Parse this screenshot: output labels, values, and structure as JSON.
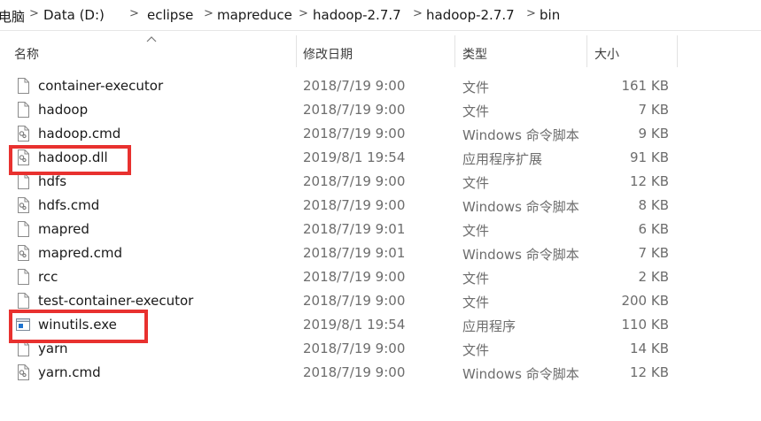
{
  "breadcrumb": {
    "items": [
      "电脑",
      "Data (D:)",
      "eclipse",
      "mapreduce",
      "hadoop-2.7.7",
      "hadoop-2.7.7",
      "bin"
    ]
  },
  "columns": {
    "name": "名称",
    "date": "修改日期",
    "type": "类型",
    "size": "大小"
  },
  "files": [
    {
      "name": "container-executor",
      "date": "2018/7/19 9:00",
      "type": "文件",
      "size": "161 KB",
      "icon": "blank-file-icon"
    },
    {
      "name": "hadoop",
      "date": "2018/7/19 9:00",
      "type": "文件",
      "size": "7 KB",
      "icon": "blank-file-icon"
    },
    {
      "name": "hadoop.cmd",
      "date": "2018/7/19 9:00",
      "type": "Windows 命令脚本",
      "size": "9 KB",
      "icon": "cmd-script-icon"
    },
    {
      "name": "hadoop.dll",
      "date": "2019/8/1 19:54",
      "type": "应用程序扩展",
      "size": "91 KB",
      "icon": "dll-gear-icon"
    },
    {
      "name": "hdfs",
      "date": "2018/7/19 9:00",
      "type": "文件",
      "size": "12 KB",
      "icon": "blank-file-icon"
    },
    {
      "name": "hdfs.cmd",
      "date": "2018/7/19 9:00",
      "type": "Windows 命令脚本",
      "size": "8 KB",
      "icon": "cmd-script-icon"
    },
    {
      "name": "mapred",
      "date": "2018/7/19 9:01",
      "type": "文件",
      "size": "6 KB",
      "icon": "blank-file-icon"
    },
    {
      "name": "mapred.cmd",
      "date": "2018/7/19 9:01",
      "type": "Windows 命令脚本",
      "size": "7 KB",
      "icon": "cmd-script-icon"
    },
    {
      "name": "rcc",
      "date": "2018/7/19 9:00",
      "type": "文件",
      "size": "2 KB",
      "icon": "blank-file-icon"
    },
    {
      "name": "test-container-executor",
      "date": "2018/7/19 9:00",
      "type": "文件",
      "size": "200 KB",
      "icon": "blank-file-icon"
    },
    {
      "name": "winutils.exe",
      "date": "2019/8/1 19:54",
      "type": "应用程序",
      "size": "110 KB",
      "icon": "exe-window-icon"
    },
    {
      "name": "yarn",
      "date": "2018/7/19 9:00",
      "type": "文件",
      "size": "14 KB",
      "icon": "blank-file-icon"
    },
    {
      "name": "yarn.cmd",
      "date": "2018/7/19 9:00",
      "type": "Windows 命令脚本",
      "size": "12 KB",
      "icon": "cmd-script-icon"
    }
  ],
  "colors": {
    "highlight": "#e8312f",
    "exe_icon_blue": "#1e73d0"
  }
}
